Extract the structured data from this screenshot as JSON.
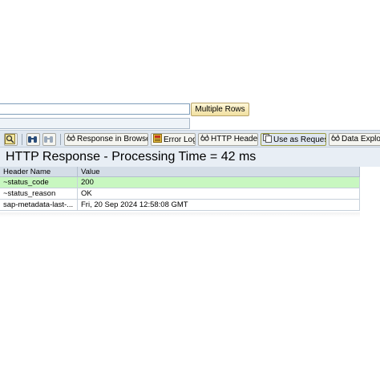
{
  "top": {
    "multiple_rows_label": "Multiple Rows"
  },
  "toolbar": {
    "response_in_browser": "Response in Browser",
    "error_log": "Error Log",
    "http_header": "HTTP Header",
    "use_as_request": "Use as Request",
    "data_explorer": "Data Explor",
    "icons": [
      "search-icon",
      "binoculars-icon",
      "binoculars-next-icon",
      "glasses-icon",
      "error-log-icon",
      "glasses-icon",
      "copy-icon",
      "glasses-icon"
    ]
  },
  "response": {
    "title": "HTTP Response - Processing Time = 42 ms"
  },
  "table": {
    "headers": [
      "Header Name",
      "Value"
    ],
    "rows": [
      {
        "name": "~status_code",
        "value": "200"
      },
      {
        "name": "~status_reason",
        "value": "OK"
      },
      {
        "name": "sap-metadata-last-...",
        "value": "Fri, 20 Sep 2024 12:58:08 GMT"
      }
    ]
  },
  "colors": {
    "highlight": "#f6f200",
    "status_row": "#c8f7c0",
    "toolbar": "#dfe7f0"
  }
}
